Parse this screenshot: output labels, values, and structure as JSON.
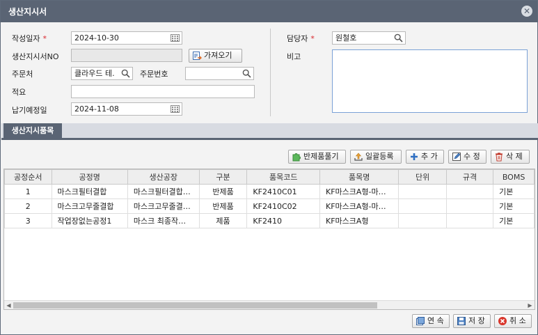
{
  "window": {
    "title": "생산지시서",
    "close_icon": "close-icon"
  },
  "form": {
    "date_label": "작성일자",
    "date_value": "2024-10-30",
    "order_no_label": "생산지시서NO",
    "order_no_value": "",
    "fetch_button": "가져오기",
    "customer_label": "주문처",
    "customer_value": "클라우드 테.",
    "order_number_label": "주문번호",
    "order_number_value": "",
    "summary_label": "적요",
    "summary_value": "",
    "due_label": "납기예정일",
    "due_value": "2024-11-08",
    "manager_label": "담당자",
    "manager_value": "원철호",
    "remark_label": "비고",
    "remark_value": "",
    "required_mark": "*"
  },
  "tab": {
    "label": "생산지시품목"
  },
  "toolbar": {
    "semi_button": "반제품풀기",
    "bulk_button": "일괄등록",
    "add_button": "추 가",
    "edit_button": "수 정",
    "delete_button": "삭 제"
  },
  "table": {
    "headers": [
      "공정순서",
      "공정명",
      "생산공장",
      "구분",
      "품목코드",
      "품목명",
      "단위",
      "규격",
      "BOMS"
    ],
    "rows": [
      [
        "1",
        "마스크필터결합",
        "마스크필터결합…",
        "반제품",
        "KF2410C01",
        "KF마스크A형-마…",
        "",
        "",
        "기본"
      ],
      [
        "2",
        "마스크고무줄결합",
        "마스크고무줄결…",
        "반제품",
        "KF2410C02",
        "KF마스크A형-마…",
        "",
        "",
        "기본"
      ],
      [
        "3",
        "작업장없는공정1",
        "마스크 최종작…",
        "제품",
        "KF2410",
        "KF마스크A형",
        "",
        "",
        "기본"
      ]
    ]
  },
  "footer": {
    "continue_button": "연 속",
    "save_button": "저 장",
    "cancel_button": "취 소"
  },
  "colors": {
    "titlebar": "#5a6474",
    "required": "#d9262b",
    "accent_border": "#7aa1d6"
  }
}
